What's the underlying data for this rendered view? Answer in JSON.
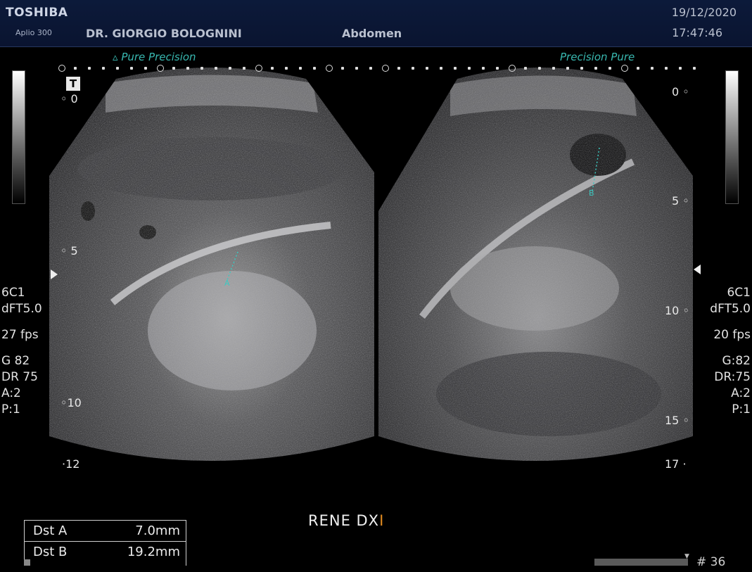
{
  "header": {
    "brand": "TOSHIBA",
    "model": "Aplio 300",
    "doctor": "DR. GIORGIO BOLOGNINI",
    "exam": "Abdomen",
    "date": "19/12/2020",
    "time": "17:47:46"
  },
  "left_panel": {
    "mode_label": "Pure Precision",
    "depth_marks": [
      "0",
      "5",
      "10",
      "12"
    ],
    "settings": {
      "probe": "6C1",
      "freq": "dFT5.0",
      "fps": "27 fps",
      "gain": "G 82",
      "dr": "DR 75",
      "a": "A:2",
      "p": "P:1"
    }
  },
  "right_panel": {
    "mode_label": "Precision  Pure",
    "depth_marks": [
      "0",
      "5",
      "10",
      "15",
      "17"
    ],
    "settings": {
      "probe": "6C1",
      "freq": "dFT5.0",
      "fps": "20 fps",
      "gain": "G:82",
      "dr": "DR:75",
      "a": "A:2",
      "p": "P:1"
    }
  },
  "measurements": [
    {
      "label": "Dst A",
      "value": "7.0mm"
    },
    {
      "label": "Dst B",
      "value": "19.2mm"
    }
  ],
  "annotation": {
    "text": "RENE DX",
    "cursor": "I"
  },
  "frame_counter": "# 36",
  "markers": {
    "a": "A",
    "b": "B",
    "top_badge": "T"
  }
}
